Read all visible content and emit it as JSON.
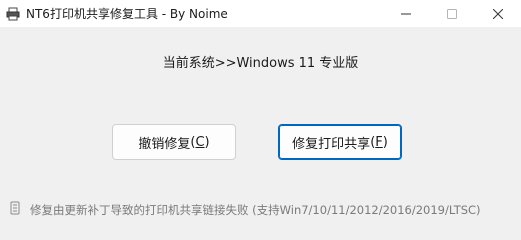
{
  "window": {
    "title": "NT6打印机共享修复工具 - By Noime"
  },
  "title_controls": {
    "minimize_icon": "minimize-icon",
    "maximize_icon": "maximize-icon",
    "close_icon": "close-icon"
  },
  "main": {
    "status": "当前系统>>Windows 11 专业版"
  },
  "buttons": {
    "undo_label": "撤销修复",
    "undo_hotkey": "C",
    "fix_label": "修复打印共享",
    "fix_hotkey": "F"
  },
  "footer": {
    "description": "修复由更新补丁导致的打印机共享链接失败 (支持Win7/10/11/2012/2016/2019/LTSC)"
  },
  "colors": {
    "accent": "#0067c0",
    "background": "#f0f0f0",
    "titlebar": "#ffffff",
    "footer_text": "#7a7a7a"
  }
}
